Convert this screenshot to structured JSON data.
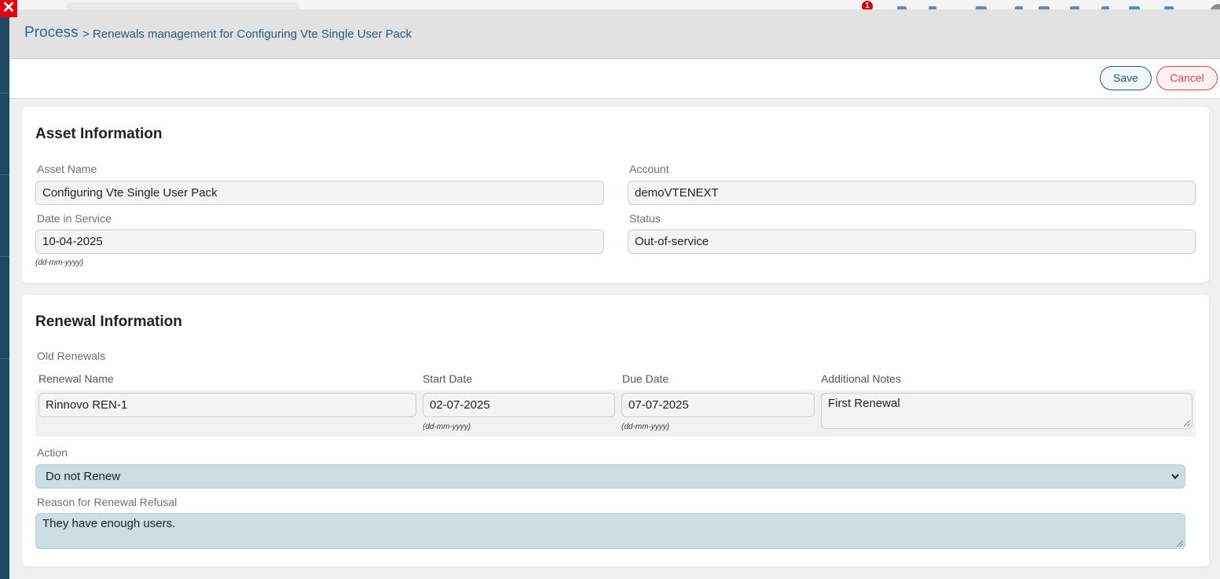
{
  "background": {
    "notification_count": "1"
  },
  "close_icon": "✕",
  "breadcrumb": {
    "root": "Process",
    "title": "> Renewals management for Configuring Vte Single User Pack"
  },
  "toolbar": {
    "save_label": "Save",
    "cancel_label": "Cancel"
  },
  "asset_info": {
    "title": "Asset Information",
    "asset_name_label": "Asset Name",
    "asset_name_value": "Configuring Vte Single User Pack",
    "account_label": "Account",
    "account_value": "demoVTENEXT",
    "date_in_service_label": "Date in Service",
    "date_in_service_value": "10-04-2025",
    "date_format_hint": "(dd-mm-yyyy)",
    "status_label": "Status",
    "status_value": "Out-of-service"
  },
  "renewal_info": {
    "title": "Renewal Information",
    "old_renewals_label": "Old Renewals",
    "columns": {
      "name": "Renewal Name",
      "start": "Start Date",
      "due": "Due Date",
      "notes": "Additional Notes"
    },
    "row": {
      "name": "Rinnovo REN-1",
      "start": "02-07-2025",
      "due": "07-07-2025",
      "notes": "First Renewal",
      "date_hint": "(dd-mm-yyyy)"
    },
    "action_label": "Action",
    "action_value": "Do not Renew",
    "reason_label": "Reason for Renewal Refusal",
    "reason_value": "They have enough users."
  },
  "colors": {
    "accent": "#2d5a78",
    "cancel": "#d9434a",
    "highlight_field": "#cddde4"
  }
}
